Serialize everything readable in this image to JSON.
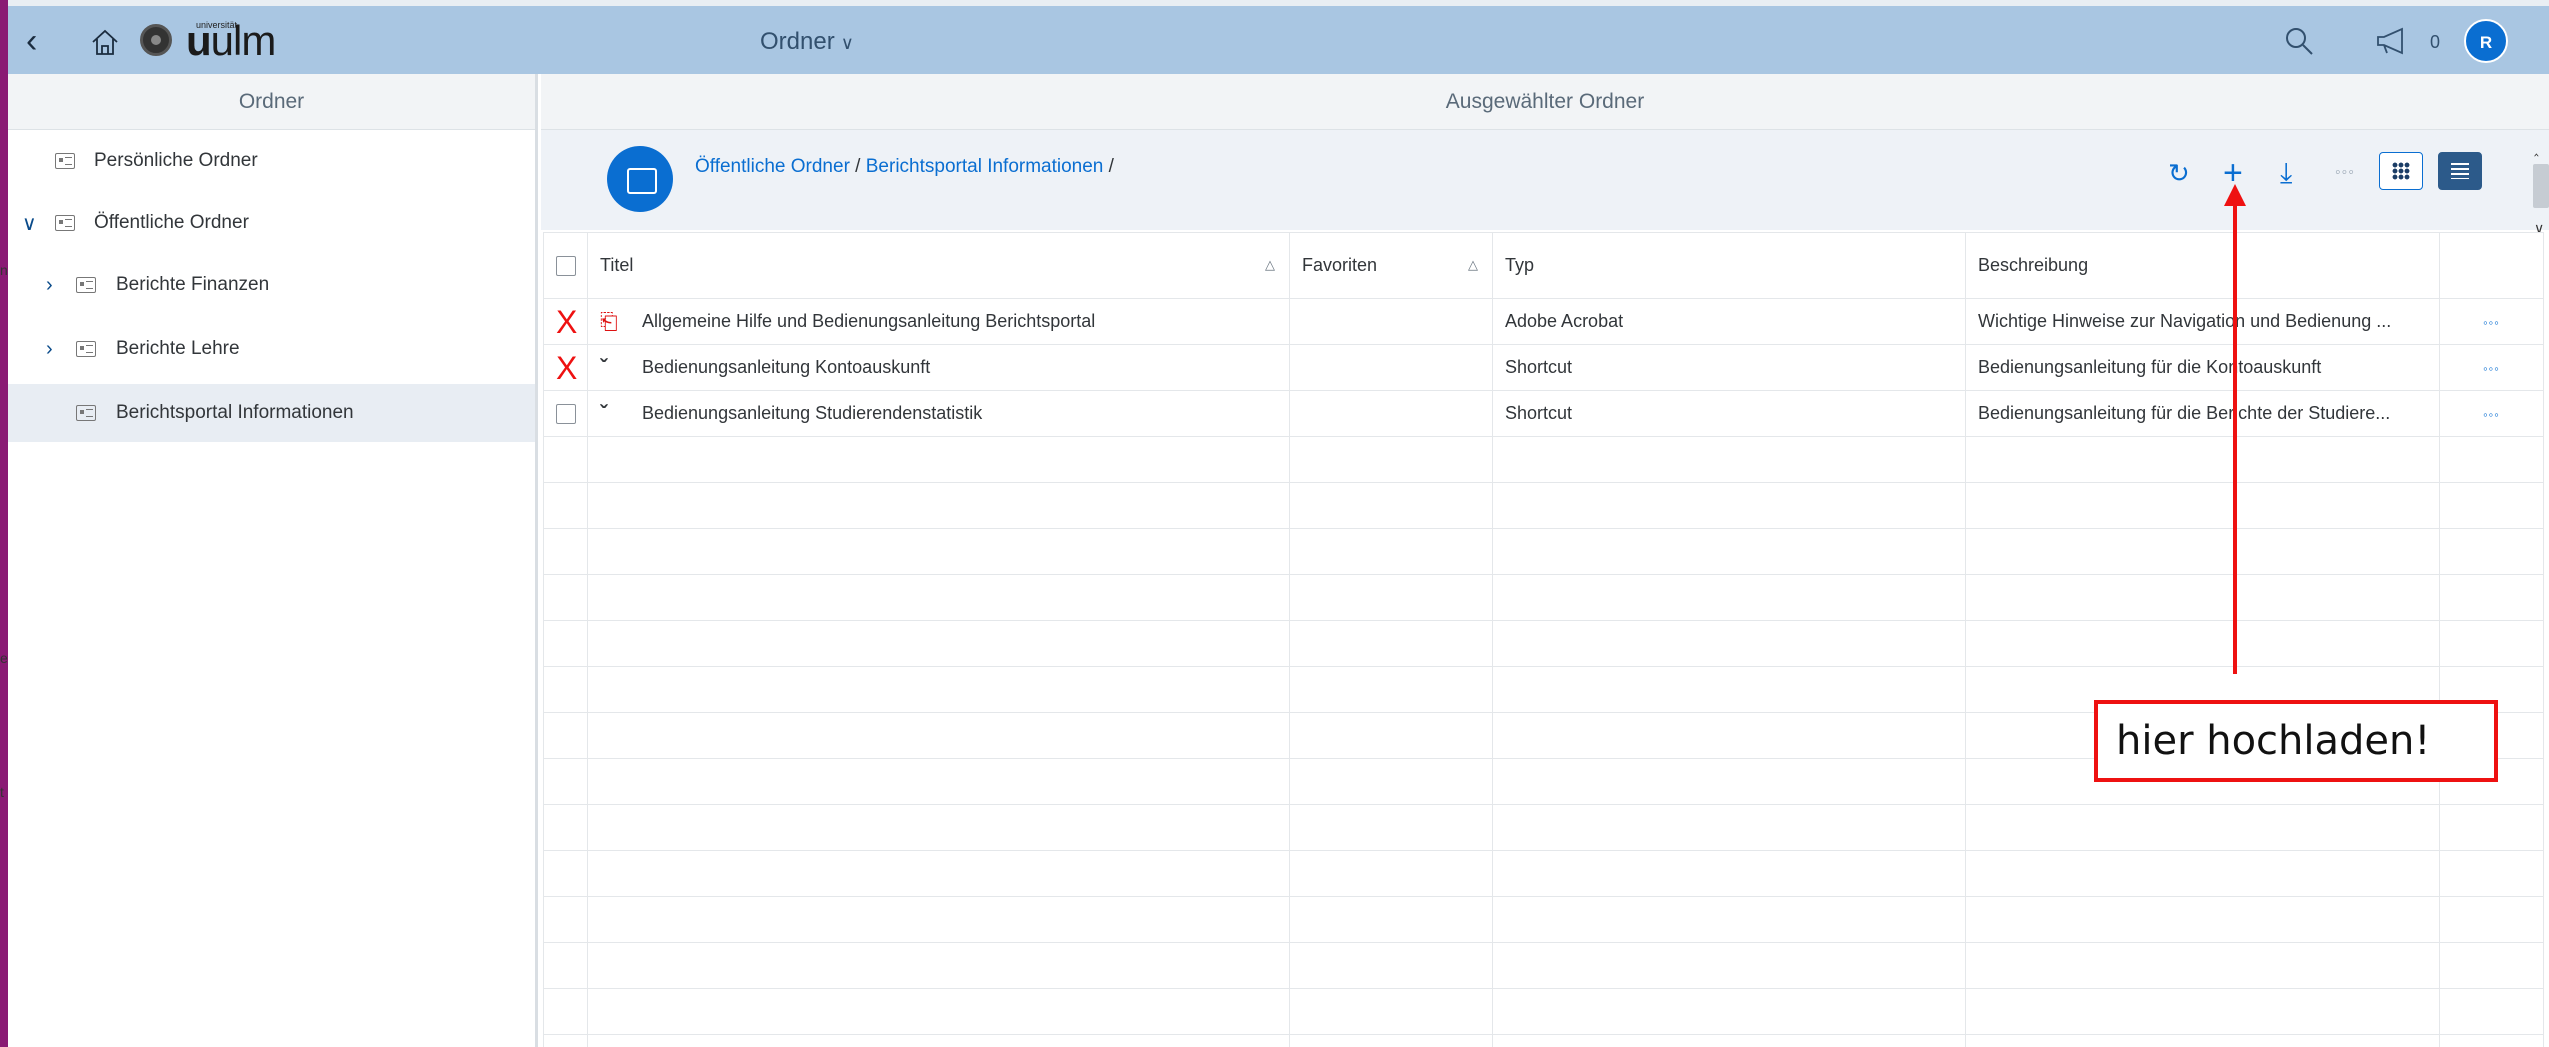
{
  "topbar": {
    "logo_small": "universität",
    "logo_bold": "u",
    "logo_rest": "ulm",
    "center_title": "Ordner",
    "notification_count": "0",
    "avatar_initial": "R"
  },
  "sidebar": {
    "title": "Ordner",
    "items": [
      {
        "label": "Persönliche Ordner"
      },
      {
        "label": "Öffentliche Ordner"
      },
      {
        "label": "Berichte Finanzen"
      },
      {
        "label": "Berichte Lehre"
      },
      {
        "label": "Berichtsportal Informationen"
      }
    ]
  },
  "main": {
    "title": "Ausgewählter Ordner",
    "breadcrumb": {
      "part1": "Öffentliche Ordner",
      "sep1": " / ",
      "part2": "Berichtsportal Informationen",
      "sep2": " /"
    },
    "toolbar": {
      "refresh": "↻",
      "add": "+",
      "download": "⤓",
      "more": "◦◦◦"
    },
    "table": {
      "columns": [
        "Titel",
        "Favoriten",
        "Typ",
        "Beschreibung"
      ],
      "rows": [
        {
          "marker": "X",
          "title": "Allgemeine Hilfe und Bedienungsanleitung Berichtsportal",
          "favorite": "",
          "type": "Adobe Acrobat",
          "description": "Wichtige Hinweise zur Navigation und Bedienung ...",
          "more": "◦◦◦"
        },
        {
          "marker": "X",
          "title": "Bedienungsanleitung Kontoauskunft",
          "favorite": "",
          "type": "Shortcut",
          "description": "Bedienungsanleitung für die Kontoauskunft",
          "more": "◦◦◦"
        },
        {
          "marker": "",
          "title": "Bedienungsanleitung Studierendenstatistik",
          "favorite": "",
          "type": "Shortcut",
          "description": "Bedienungsanleitung für die Berichte der Studiere...",
          "more": "◦◦◦"
        }
      ]
    }
  },
  "annotation": {
    "text": "hier hochladen!",
    "color": "#e11111"
  },
  "colors": {
    "topbar": "#a9c6e2",
    "accent": "#0a6ed1",
    "left_strip": "#8a1a74"
  }
}
